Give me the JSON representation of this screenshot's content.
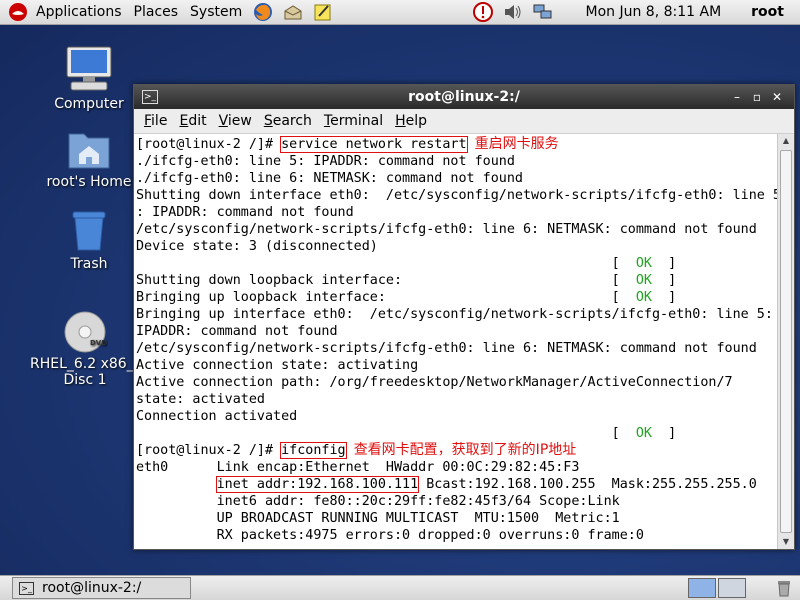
{
  "top_panel": {
    "menus": [
      "Applications",
      "Places",
      "System"
    ],
    "clock": "Mon Jun  8,  8:11 AM",
    "user": "root"
  },
  "desktop": {
    "icons": [
      {
        "label": "Computer"
      },
      {
        "label": "root's Home"
      },
      {
        "label": "Trash"
      },
      {
        "label_line1": "RHEL_6.2 x86_6",
        "label_line2": "Disc 1",
        "badge": "DVD"
      }
    ]
  },
  "window": {
    "title": "root@linux-2:/",
    "controls": [
      "–",
      "▫",
      "✕"
    ],
    "menus": [
      {
        "key": "F",
        "rest": "ile"
      },
      {
        "key": "E",
        "rest": "dit"
      },
      {
        "key": "V",
        "rest": "iew"
      },
      {
        "key": "S",
        "rest": "earch"
      },
      {
        "key": "T",
        "rest": "erminal"
      },
      {
        "key": "H",
        "rest": "elp"
      }
    ]
  },
  "terminal": {
    "prompt": "[root@linux-2 /]# ",
    "cmd1": "service network restart",
    "annot1": "重启网卡服务",
    "lines_a": [
      "./ifcfg-eth0: line 5: IPADDR: command not found",
      "./ifcfg-eth0: line 6: NETMASK: command not found",
      "Shutting down interface eth0:  /etc/sysconfig/network-scripts/ifcfg-eth0: line 5",
      ": IPADDR: command not found",
      "/etc/sysconfig/network-scripts/ifcfg-eth0: line 6: NETMASK: command not found",
      "Device state: 3 (disconnected)"
    ],
    "ok_lead_a": "                                                           [  ",
    "ok_text": "OK",
    "ok_tail": "  ]",
    "loop_down": "Shutting down loopback interface:                          [  ",
    "loop_up": "Bringing up loopback interface:                            [  ",
    "lines_b": [
      "Bringing up interface eth0:  /etc/sysconfig/network-scripts/ifcfg-eth0: line 5:",
      "IPADDR: command not found",
      "/etc/sysconfig/network-scripts/ifcfg-eth0: line 6: NETMASK: command not found",
      "Active connection state: activating",
      "Active connection path: /org/freedesktop/NetworkManager/ActiveConnection/7",
      "state: activated",
      "Connection activated"
    ],
    "cmd2": "ifconfig",
    "annot2": "查看网卡配置，获取到了新的IP地址",
    "eth0_line1": "eth0      Link encap:Ethernet  HWaddr 00:0C:29:82:45:F3",
    "indent": "          ",
    "inet_addr": "inet addr:192.168.100.111",
    "inet_rest": " Bcast:192.168.100.255  Mask:255.255.255.0",
    "lines_c": [
      "          inet6 addr: fe80::20c:29ff:fe82:45f3/64 Scope:Link",
      "          UP BROADCAST RUNNING MULTICAST  MTU:1500  Metric:1",
      "          RX packets:4975 errors:0 dropped:0 overruns:0 frame:0"
    ]
  },
  "bottom_panel": {
    "task_label": "root@linux-2:/"
  }
}
